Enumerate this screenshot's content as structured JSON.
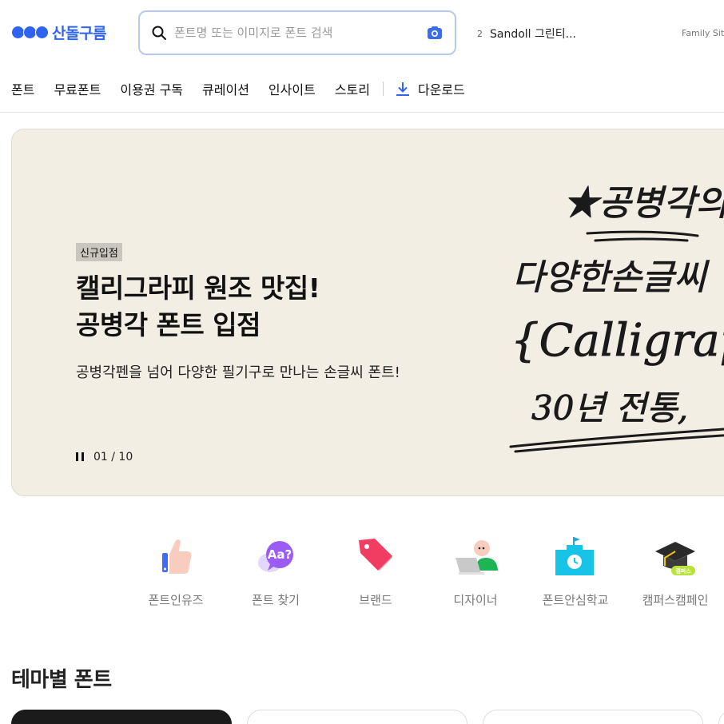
{
  "header": {
    "logo_text": "산돌구름",
    "search_placeholder": "폰트명 또는 이미지로 폰트 검색",
    "rank_number": "2",
    "rank_text": "Sandoll 그린티...",
    "family_site": "Family Site"
  },
  "nav": {
    "items": [
      "폰트",
      "무료폰트",
      "이용권 구독",
      "큐레이션",
      "인사이트",
      "스토리"
    ],
    "download": "다운로드"
  },
  "hero": {
    "badge": "신규입점",
    "title_line1": "캘리그라피 원조 맛집!",
    "title_line2": "공병각 폰트 입점",
    "subtitle": "공병각펜을 넘어 다양한 필기구로 만나는 손글씨 폰트!",
    "counter": "01 / 10",
    "art_lines": [
      "★공병각의",
      "다양한손글씨",
      "{Calligraphy",
      "30년 전통,"
    ]
  },
  "categories": [
    {
      "label": "폰트인유즈",
      "icon": "thumbs-up-icon"
    },
    {
      "label": "폰트 찾기",
      "icon": "speech-bubble-aa-icon"
    },
    {
      "label": "브랜드",
      "icon": "price-tag-icon"
    },
    {
      "label": "디자이너",
      "icon": "designer-laptop-icon"
    },
    {
      "label": "폰트안심학교",
      "icon": "school-clock-icon"
    },
    {
      "label": "캠퍼스캠페인",
      "icon": "graduation-cap-icon",
      "tag": "캠퍼스"
    }
  ],
  "section": {
    "title": "테마별 폰트"
  },
  "colors": {
    "brand": "#2f63f0",
    "hero_bg": "#f2eee4",
    "search_border": "#b9c8f0"
  }
}
